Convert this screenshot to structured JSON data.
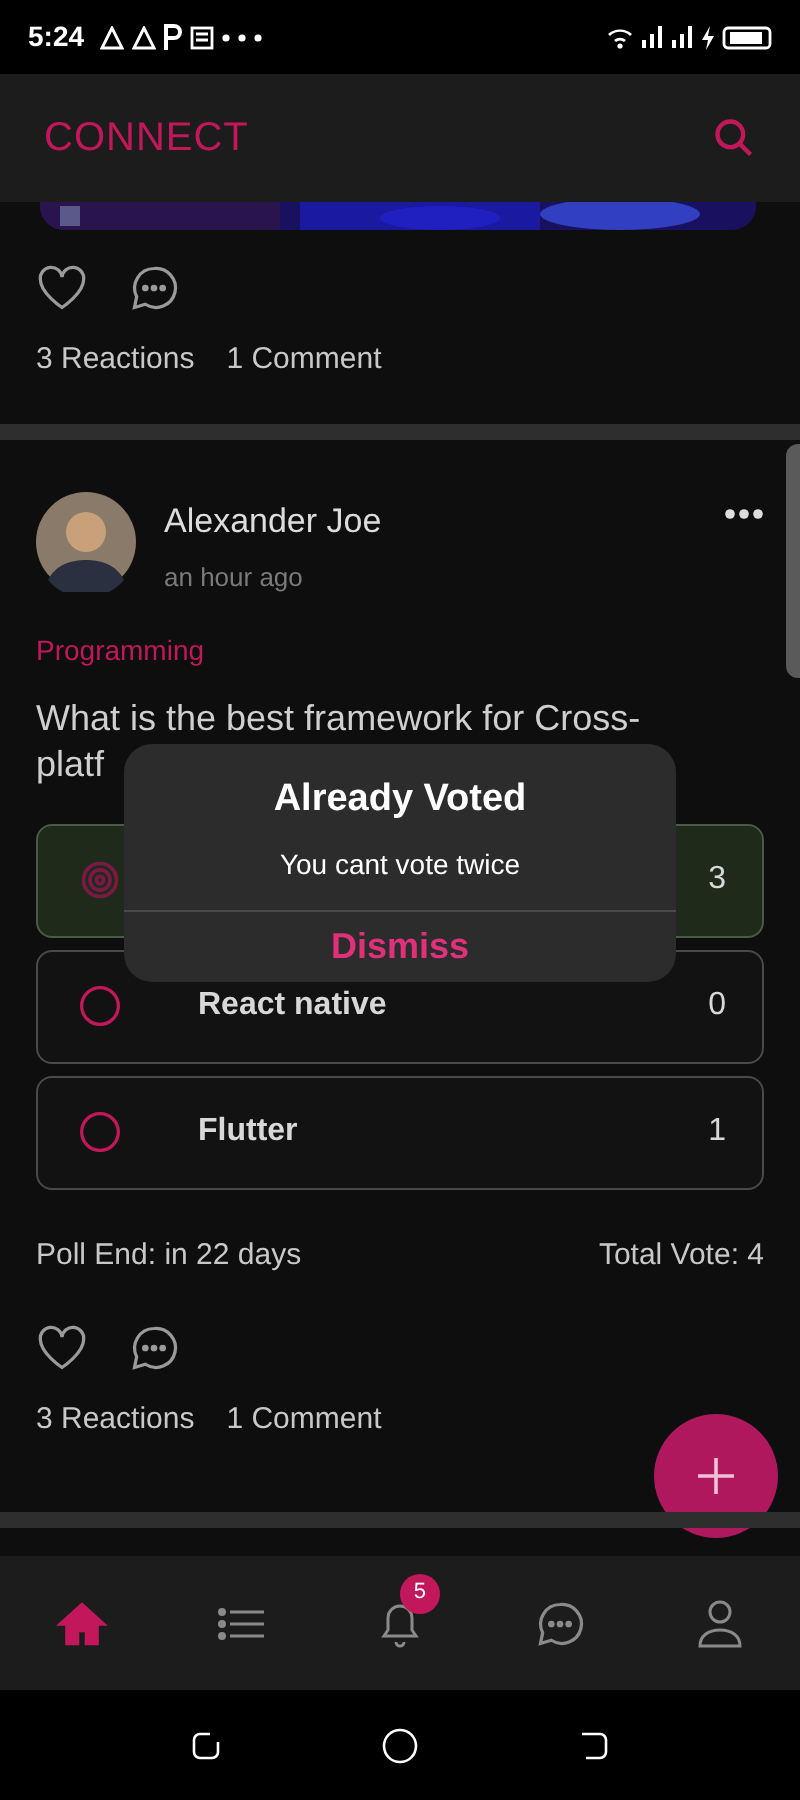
{
  "status_bar": {
    "time": "5:24"
  },
  "header": {
    "title": "CONNECT"
  },
  "previous_post": {
    "reactions": "3 Reactions",
    "comments": "1 Comment"
  },
  "post": {
    "author": "Alexander Joe",
    "time": "an hour ago",
    "category": "Programming",
    "question_lines": [
      "What is the best framework for Cross-",
      "platf"
    ],
    "options": [
      {
        "count": "3",
        "selected": true
      },
      {
        "label": "React native",
        "count": "0",
        "selected": false
      },
      {
        "label": "Flutter",
        "count": "1",
        "selected": false
      }
    ],
    "poll_end": "Poll End: in 22 days",
    "total": "Total Vote: 4",
    "reactions": "3 Reactions",
    "comments": "1 Comment"
  },
  "dialog": {
    "title": "Already Voted",
    "message": "You cant vote twice",
    "button": "Dismiss"
  },
  "bottom_nav": [
    {
      "kind": "home",
      "selected": true
    },
    {
      "kind": "list",
      "selected": false
    },
    {
      "kind": "bell",
      "selected": false,
      "badge": "5"
    },
    {
      "kind": "chat",
      "selected": false
    },
    {
      "kind": "profile",
      "selected": false
    }
  ]
}
